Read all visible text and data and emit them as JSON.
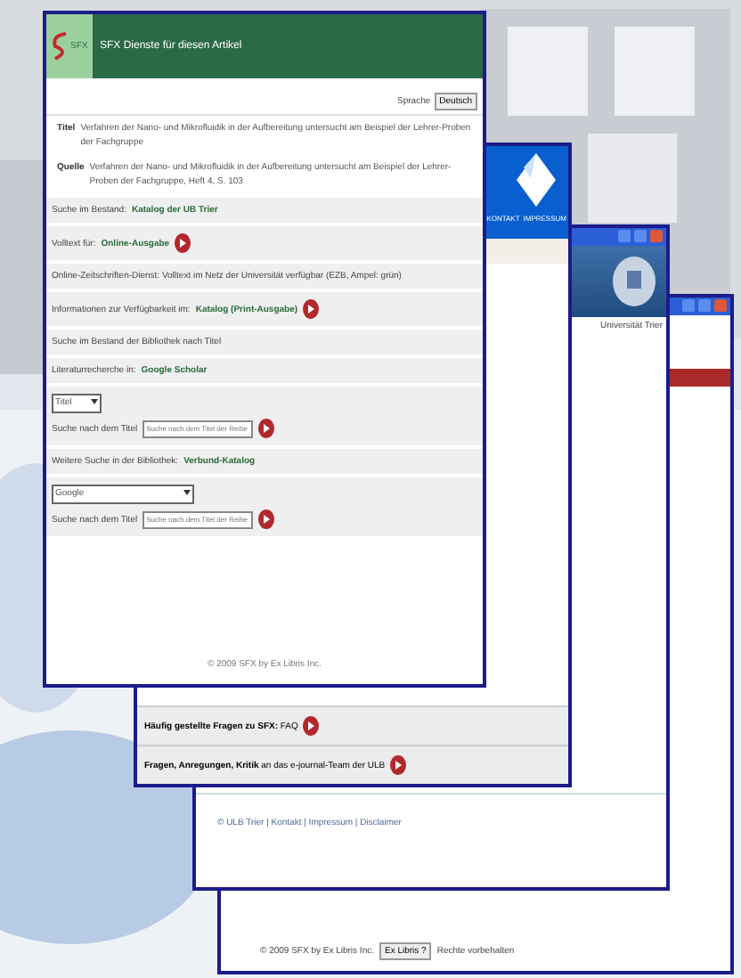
{
  "front_window": {
    "logo": "SFX",
    "title": "SFX Dienste für diesen Artikel",
    "language_label": "Sprache",
    "language_button": "Deutsch",
    "citation": [
      {
        "label": "Titel",
        "text": "Verfahren der Nano- und Mikrofluidik in der Aufbereitung untersucht am Beispiel der Lehrer-Proben der Fachgruppe"
      },
      {
        "label": "Quelle",
        "text": "Verfahren der Nano- und Mikrofluidik in der Aufbereitung untersucht am Beispiel der Lehrer-Proben der Fachgruppe, Heft 4, S. 103"
      }
    ],
    "services": [
      {
        "kind": "link",
        "text": "Suche im Bestand:",
        "link": "Katalog der UB Trier",
        "go": false
      },
      {
        "kind": "link",
        "text": "Volltext für:",
        "link": "Online-Ausgabe",
        "go": true
      },
      {
        "kind": "note",
        "text": "Online-Zeitschriften-Dienst: Volltext im Netz der Universität verfügbar (EZB, Ampel: grün)"
      },
      {
        "kind": "link",
        "text": "Informationen zur Verfügbarkeit im:",
        "link": "Katalog (Print-Ausgabe)",
        "go": true
      },
      {
        "kind": "note",
        "text": "Suche im Bestand der Bibliothek nach Titel"
      },
      {
        "kind": "link",
        "text": "Literaturrecherche in:",
        "link": "Google Scholar",
        "go": false
      },
      {
        "kind": "search",
        "select": "Titel",
        "label": "Suche nach dem Titel",
        "placeholder": "Suche nach dem Titel der Reihe",
        "go": true
      },
      {
        "kind": "link",
        "text": "Weitere Suche in der Bibliothek:",
        "link": "Verbund-Katalog",
        "go": false
      },
      {
        "kind": "search",
        "select": "Google",
        "label": "Suche nach dem Titel",
        "placeholder": "Suche nach dem Titel der Reihe",
        "go": true
      }
    ],
    "footer": "© 2009 SFX by Ex Libris Inc."
  },
  "second_window": {
    "nav": [
      "KONTAKT",
      "IMPRESSUM"
    ],
    "rows": [
      {
        "bold": "Häufig gestellte Fragen zu SFX:",
        "text": "FAQ"
      },
      {
        "bold": "Fragen, Anregungen, Kritik",
        "text": "an das e-journal-Team der ULB"
      }
    ]
  },
  "third_window": {
    "header_note": "Universität Trier",
    "footer": "© ULB Trier | Kontakt | Impressum | Disclaimer"
  },
  "back_window": {
    "footer": "© 2009 SFX by Ex Libris Inc.",
    "footer_button": "Ex Libris ?",
    "footer_note": "Rechte vorbehalten"
  }
}
